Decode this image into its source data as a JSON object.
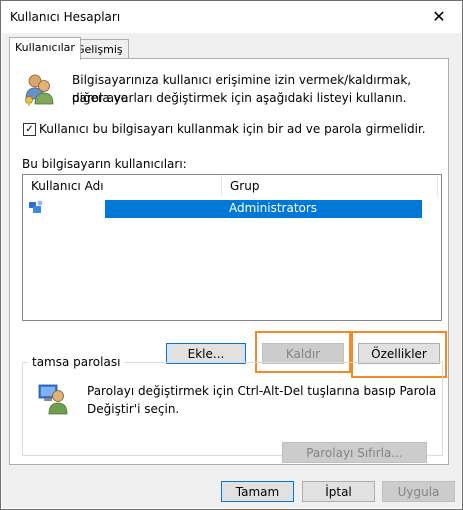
{
  "window": {
    "title": "Kullanıcı Hesapları",
    "close_glyph": "✕"
  },
  "tabs": [
    {
      "label": "Kullanıcılar"
    },
    {
      "label": "Gelişmiş"
    }
  ],
  "intro_text_line1": "Bilgisayarınıza kullanıcı erişimine izin vermek/kaldırmak, parola ve",
  "intro_text_line2": "diğer ayarları değiştirmek için aşağıdaki listeyi kullanın.",
  "require_password": {
    "label": "Kullanıcı bu bilgisayarı kullanmak için bir ad ve parola girmelidir.",
    "checked": true,
    "check_glyph": "✓"
  },
  "users_label": "Bu bilgisayarın kullanıcıları:",
  "users_table": {
    "columns": [
      "Kullanıcı Adı",
      "Grup"
    ],
    "rows": [
      {
        "name": "",
        "group": "Administrators"
      }
    ]
  },
  "buttons": {
    "add": "Ekle...",
    "remove": "Kaldır",
    "properties": "Özellikler"
  },
  "password_group": {
    "legend": "tamsa parolası",
    "text_line1": "Parolayı değiştirmek için Ctrl-Alt-Del tuşlarına basıp Parola",
    "text_line2": "Değiştir'i seçin.",
    "reset_button": "Parolayı Sıfırla..."
  },
  "footer": {
    "ok": "Tamam",
    "cancel": "İptal",
    "apply": "Uygula"
  },
  "colors": {
    "highlight": "#f08a24",
    "selection": "#0078d7"
  }
}
